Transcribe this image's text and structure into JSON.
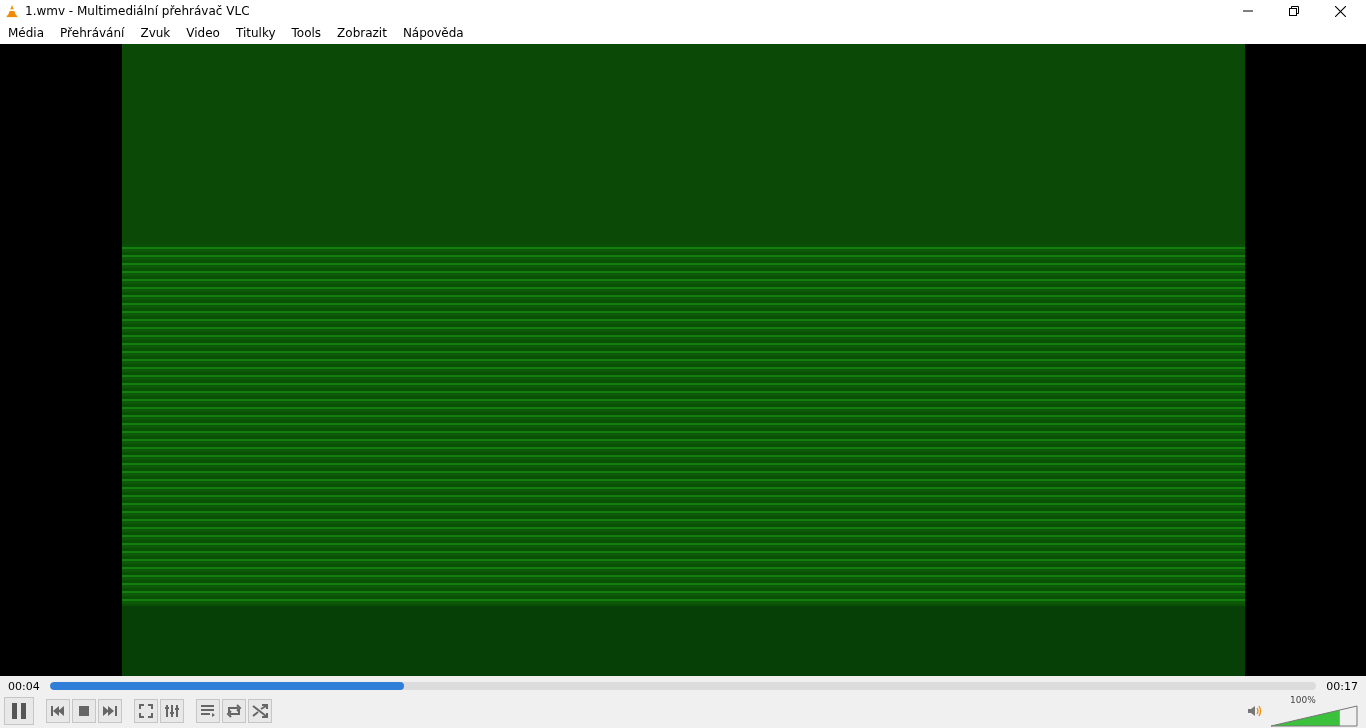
{
  "window": {
    "title": "1.wmv - Multimediální přehrávač VLC"
  },
  "menu": [
    "Média",
    "Přehrávání",
    "Zvuk",
    "Video",
    "Titulky",
    "Tools",
    "Zobrazit",
    "Nápověda"
  ],
  "seek": {
    "elapsed": "00:04",
    "total": "00:17",
    "level": 0.28
  },
  "playback": {
    "playing": true
  },
  "volume": {
    "reading": "100%",
    "level": 0.8,
    "muted": false
  }
}
